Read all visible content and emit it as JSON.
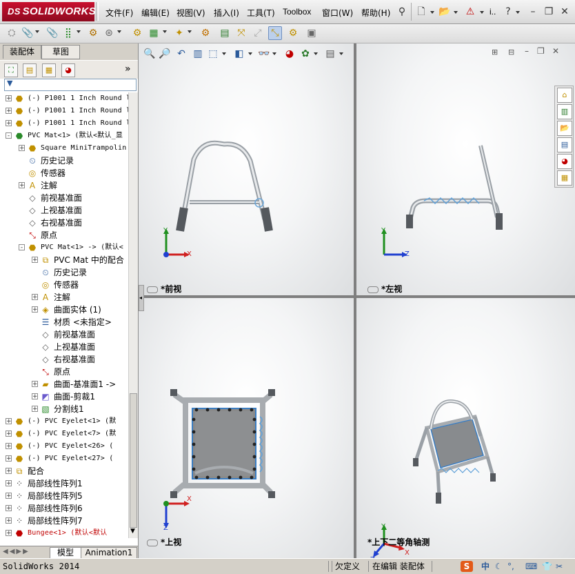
{
  "app": {
    "logo": "SOLIDWORKS",
    "logo_prefix": "DS"
  },
  "menu": [
    "文件(F)",
    "编辑(E)",
    "视图(V)",
    "插入(I)",
    "工具(T)",
    "Toolbox",
    "窗口(W)",
    "帮助(H)"
  ],
  "title_right": {
    "more": "i.."
  },
  "panel_tabs": {
    "assembly": "装配体",
    "sketch": "草图"
  },
  "panel_expand": "»",
  "tree": [
    {
      "label": "(-) P1001 1 Inch Round l",
      "mono": true,
      "pm": "+",
      "indent": 0,
      "icon": "part-icon"
    },
    {
      "label": "(-) P1001 1 Inch Round l",
      "mono": true,
      "pm": "+",
      "indent": 0,
      "icon": "part-icon"
    },
    {
      "label": "(-) P1001 1 Inch Round l",
      "mono": true,
      "pm": "+",
      "indent": 0,
      "icon": "part-icon"
    },
    {
      "label": "PVC Mat<1> (默认<默认_显",
      "mono": true,
      "pm": "-",
      "indent": 0,
      "icon": "subassembly-icon"
    },
    {
      "label": "Square MiniTrampolin",
      "mono": true,
      "pm": "+",
      "indent": 1,
      "icon": "part-icon"
    },
    {
      "label": "历史记录",
      "pm": "",
      "indent": 1,
      "icon": "history-icon"
    },
    {
      "label": "传感器",
      "pm": "",
      "indent": 1,
      "icon": "sensor-icon"
    },
    {
      "label": "注解",
      "pm": "+",
      "indent": 1,
      "icon": "annotation-icon"
    },
    {
      "label": "前视基准面",
      "pm": "",
      "indent": 1,
      "icon": "plane-icon"
    },
    {
      "label": "上视基准面",
      "pm": "",
      "indent": 1,
      "icon": "plane-icon"
    },
    {
      "label": "右视基准面",
      "pm": "",
      "indent": 1,
      "icon": "plane-icon"
    },
    {
      "label": "原点",
      "pm": "",
      "indent": 1,
      "icon": "origin-icon"
    },
    {
      "label": "PVC Mat<1> -> (默认<",
      "mono": true,
      "pm": "-",
      "indent": 1,
      "icon": "part-icon"
    },
    {
      "label": "PVC Mat 中的配合",
      "pm": "+",
      "indent": 2,
      "icon": "mates-icon"
    },
    {
      "label": "历史记录",
      "pm": "",
      "indent": 2,
      "icon": "history-icon"
    },
    {
      "label": "传感器",
      "pm": "",
      "indent": 2,
      "icon": "sensor-icon"
    },
    {
      "label": "注解",
      "pm": "+",
      "indent": 2,
      "icon": "annotation-icon"
    },
    {
      "label": "曲面实体 (1)",
      "pm": "+",
      "indent": 2,
      "icon": "surface-body-icon"
    },
    {
      "label": "材质 <未指定>",
      "pm": "",
      "indent": 2,
      "icon": "material-icon"
    },
    {
      "label": "前视基准面",
      "pm": "",
      "indent": 2,
      "icon": "plane-icon"
    },
    {
      "label": "上视基准面",
      "pm": "",
      "indent": 2,
      "icon": "plane-icon"
    },
    {
      "label": "右视基准面",
      "pm": "",
      "indent": 2,
      "icon": "plane-icon"
    },
    {
      "label": "原点",
      "pm": "",
      "indent": 2,
      "icon": "origin-icon"
    },
    {
      "label": "曲面-基准面1 ->",
      "pm": "+",
      "indent": 2,
      "icon": "surface-plane-icon"
    },
    {
      "label": "曲面-剪裁1",
      "pm": "+",
      "indent": 2,
      "icon": "surface-trim-icon"
    },
    {
      "label": "分割线1",
      "pm": "+",
      "indent": 2,
      "icon": "split-line-icon"
    },
    {
      "label": "(-) PVC Eyelet<1> (默",
      "mono": true,
      "pm": "+",
      "indent": 0,
      "icon": "part-icon"
    },
    {
      "label": "(-) PVC Eyelet<7> (默",
      "mono": true,
      "pm": "+",
      "indent": 0,
      "icon": "part-icon"
    },
    {
      "label": "(-) PVC Eyelet<26> (",
      "mono": true,
      "pm": "+",
      "indent": 0,
      "icon": "part-icon"
    },
    {
      "label": "(-) PVC Eyelet<27> (",
      "mono": true,
      "pm": "+",
      "indent": 0,
      "icon": "part-icon"
    },
    {
      "label": "配合",
      "pm": "+",
      "indent": 0,
      "icon": "mates-icon"
    },
    {
      "label": "局部线性阵列1",
      "pm": "+",
      "indent": 0,
      "icon": "pattern-icon"
    },
    {
      "label": "局部线性阵列5",
      "pm": "+",
      "indent": 0,
      "icon": "pattern-icon"
    },
    {
      "label": "局部线性阵列6",
      "pm": "+",
      "indent": 0,
      "icon": "pattern-icon"
    },
    {
      "label": "局部线性阵列7",
      "pm": "+",
      "indent": 0,
      "icon": "pattern-icon"
    },
    {
      "label": "Bungee<1> (默认<默认",
      "mono": true,
      "red": true,
      "pm": "+",
      "indent": 0,
      "icon": "error-part-icon"
    }
  ],
  "bottom_tabs": {
    "model": "模型",
    "animation": "Animation1"
  },
  "viewports": {
    "front": "*前视",
    "left": "*左视",
    "top": "*上视",
    "iso": "*上下二等角轴测"
  },
  "axes": {
    "x": "X",
    "y": "Y",
    "z": "Z"
  },
  "status": {
    "app_version": "SolidWorks 2014",
    "underdefined": "欠定义",
    "editing": "在编辑 装配体",
    "ime": "中"
  },
  "colors": {
    "brand": "#c8102e",
    "axis_x": "#d02020",
    "axis_y": "#209020",
    "axis_z": "#2040d0",
    "mat": "#8a8a8a",
    "frame": "#b8bcc0"
  }
}
